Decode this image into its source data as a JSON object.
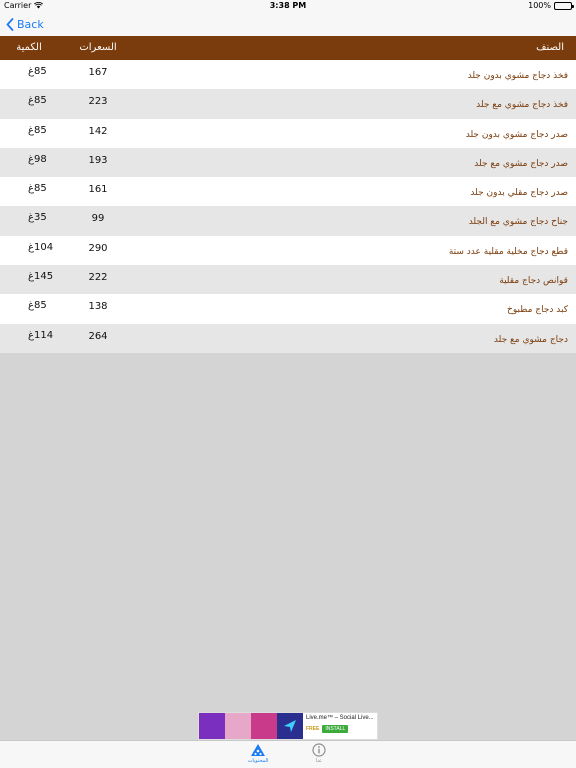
{
  "status_bar": {
    "carrier": "Carrier",
    "time": "3:38 PM",
    "battery": "100%"
  },
  "nav": {
    "back_label": "Back"
  },
  "table": {
    "headers": {
      "item": "الصنف",
      "calories": "السعرات",
      "quantity": "الكمية"
    },
    "rows": [
      {
        "item": "فخذ دجاج مشوي بدون جلد",
        "calories": "167",
        "quantity": "85غ"
      },
      {
        "item": "فخذ دجاج مشوي مع جلد",
        "calories": "223",
        "quantity": "85غ"
      },
      {
        "item": "صدر دجاج مشوي بدون جلد",
        "calories": "142",
        "quantity": "85غ"
      },
      {
        "item": "صدر دجاج مشوي مع جلد",
        "calories": "193",
        "quantity": "98غ"
      },
      {
        "item": "صدر دجاج مقلي بدون جلد",
        "calories": "161",
        "quantity": "85غ"
      },
      {
        "item": "جناح دجاج مشوي مع الجلد",
        "calories": "99",
        "quantity": "35غ"
      },
      {
        "item": "قطع دجاج مخلية مقلية عدد ستة",
        "calories": "290",
        "quantity": "104غ"
      },
      {
        "item": "قوانص دجاج مقلية",
        "calories": "222",
        "quantity": "145غ"
      },
      {
        "item": "كبد دجاج مطبوخ",
        "calories": "138",
        "quantity": "85غ"
      },
      {
        "item": "دجاج مشوي مع جلد",
        "calories": "264",
        "quantity": "114غ"
      }
    ]
  },
  "ad": {
    "title": "Live.me™ – Social Live...",
    "free": "FREE",
    "install": "INSTALL"
  },
  "tabs": [
    {
      "label": "المحتويات",
      "icon": "pizza-icon",
      "active": true
    },
    {
      "label": "عنا",
      "icon": "info-icon",
      "active": false
    }
  ],
  "colors": {
    "header_bg": "#7a3c0c",
    "item_text": "#7a3c0c",
    "accent": "#1a7cf5",
    "row_alt": "#e6e6e6"
  }
}
